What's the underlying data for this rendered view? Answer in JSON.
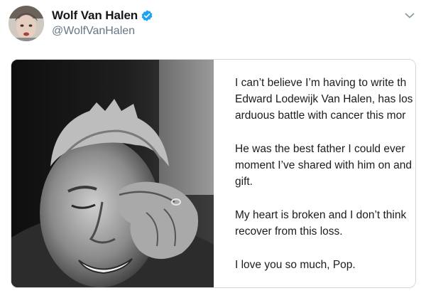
{
  "author": {
    "display_name": "Wolf Van Halen",
    "handle": "@WolfVanHalen",
    "verified": true,
    "verified_color": "#1da1f2"
  },
  "statement": {
    "paragraphs": [
      {
        "lines": [
          "I can’t believe I’m having to write th",
          "Edward Lodewijk Van Halen, has los",
          "arduous battle with cancer this mor"
        ]
      },
      {
        "lines": [
          "He was the best father I could ever",
          "moment I’ve shared with him on and",
          "gift."
        ]
      },
      {
        "lines": [
          "My heart is broken and I don’t think",
          "recover from this loss."
        ]
      },
      {
        "lines": [
          "I love you so much, Pop."
        ]
      }
    ]
  },
  "icons": {
    "verified": "verified-badge-icon",
    "menu": "chevron-down-icon"
  }
}
